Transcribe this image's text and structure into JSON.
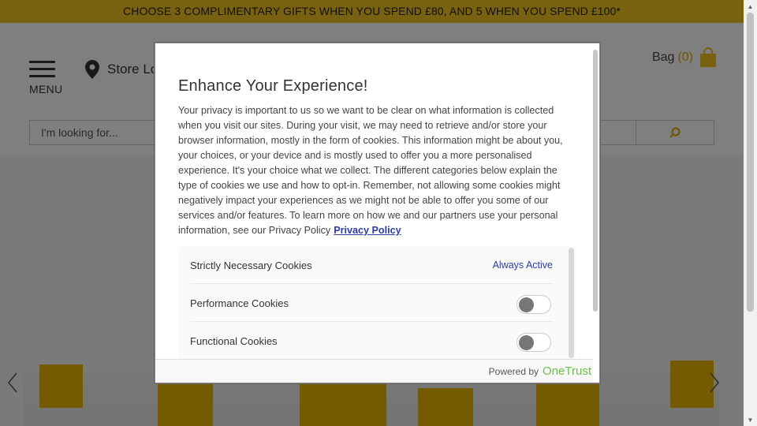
{
  "promo": {
    "text": "CHOOSE 3 COMPLIMENTARY GIFTS WHEN YOU SPEND £80, AND 5 WHEN YOU SPEND £100*"
  },
  "header": {
    "menu_label": "MENU",
    "store_locator_label": "Store Lo",
    "bag_label": "Bag",
    "bag_count": "(0)",
    "search_placeholder": "I'm looking for...",
    "accent_color": "#f2c324"
  },
  "modal": {
    "title": "Enhance Your Experience!",
    "description": "Your privacy is important to us so we want to be clear on what information is collected when you visit our sites. During your visit, we may need to retrieve and/or store your browser information, mostly in the form of cookies. This information might be about you, your choices, or your device and is mostly used to offer you a more personalised experience. It's your choice what we collect. The different categories below explain the type of cookies we use and how to opt-in. Remember, not allowing some cookies might negatively impact your experiences as we might not be able to offer you some of our services and/or features. To learn more on how we and our partners use your personal information, see our Privacy Policy",
    "privacy_link": "Privacy Policy",
    "categories": [
      {
        "name": "Strictly Necessary Cookies",
        "status": "Always Active"
      },
      {
        "name": "Performance Cookies",
        "enabled": false
      },
      {
        "name": "Functional Cookies",
        "enabled": false
      }
    ],
    "footer_powered": "Powered by",
    "footer_brand": "OneTrust"
  },
  "icons": [
    "menu-icon",
    "location-pin-icon",
    "shopping-bag-icon",
    "search-icon",
    "chevron-left-icon",
    "chevron-right-icon"
  ]
}
